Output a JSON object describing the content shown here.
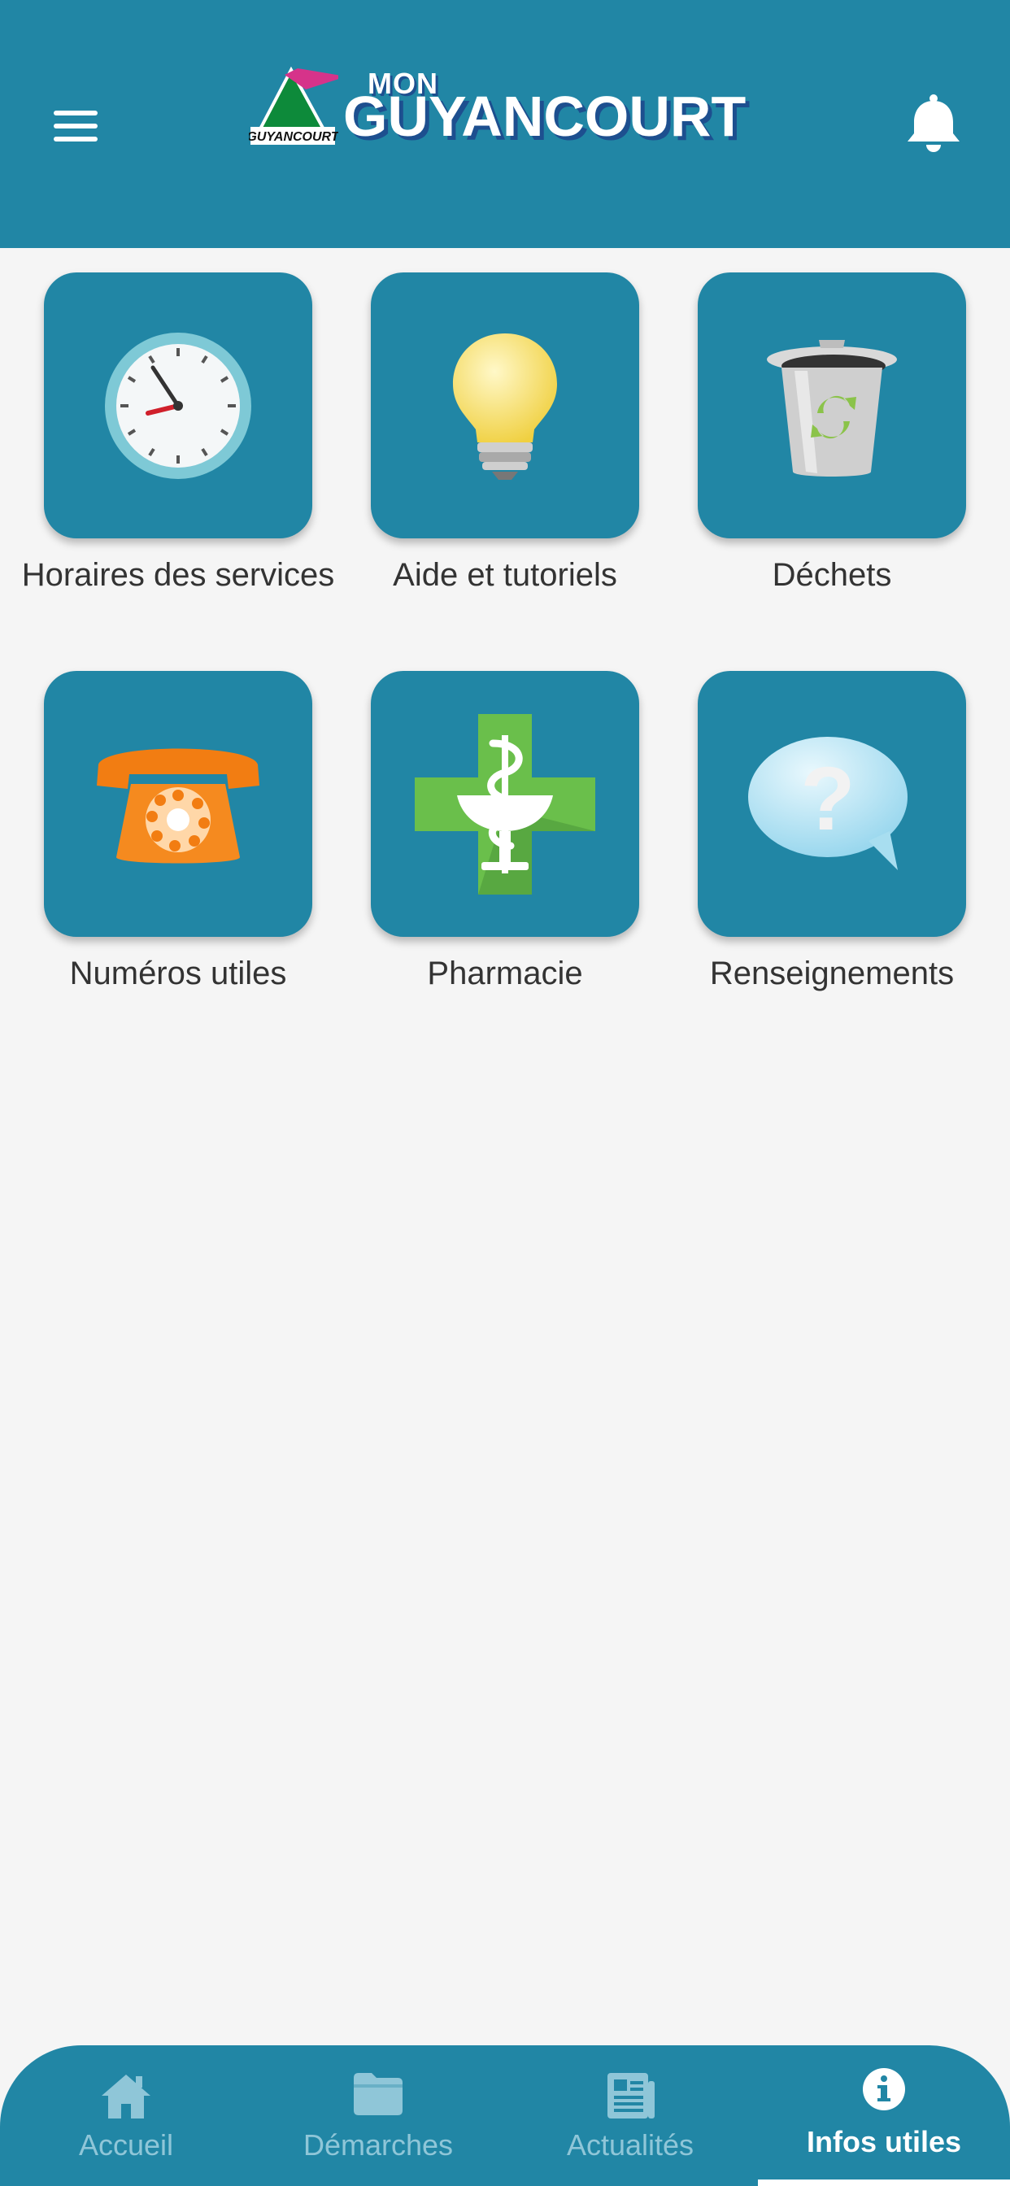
{
  "header": {
    "logo_mon": "MON",
    "logo_name": "GUYANCOURT",
    "logo_badge": "GUYANCOURT"
  },
  "tiles": [
    {
      "label": "Horaires des services",
      "icon": "clock-icon"
    },
    {
      "label": "Aide et tutoriels",
      "icon": "lightbulb-icon"
    },
    {
      "label": "Déchets",
      "icon": "trash-bin-icon"
    },
    {
      "label": "Numéros utiles",
      "icon": "telephone-icon"
    },
    {
      "label": "Pharmacie",
      "icon": "pharmacy-cross-icon"
    },
    {
      "label": "Renseignements",
      "icon": "question-bubble-icon"
    }
  ],
  "tabbar": {
    "tabs": [
      {
        "label": "Accueil",
        "icon": "home-icon",
        "active": false
      },
      {
        "label": "Démarches",
        "icon": "folder-icon",
        "active": false
      },
      {
        "label": "Actualités",
        "icon": "newspaper-icon",
        "active": false
      },
      {
        "label": "Infos utiles",
        "icon": "info-icon",
        "active": true
      }
    ]
  },
  "colors": {
    "primary": "#2186a5",
    "background": "#f5f5f5",
    "tab_inactive": "#8fc6d8",
    "tab_active": "#ffffff"
  }
}
